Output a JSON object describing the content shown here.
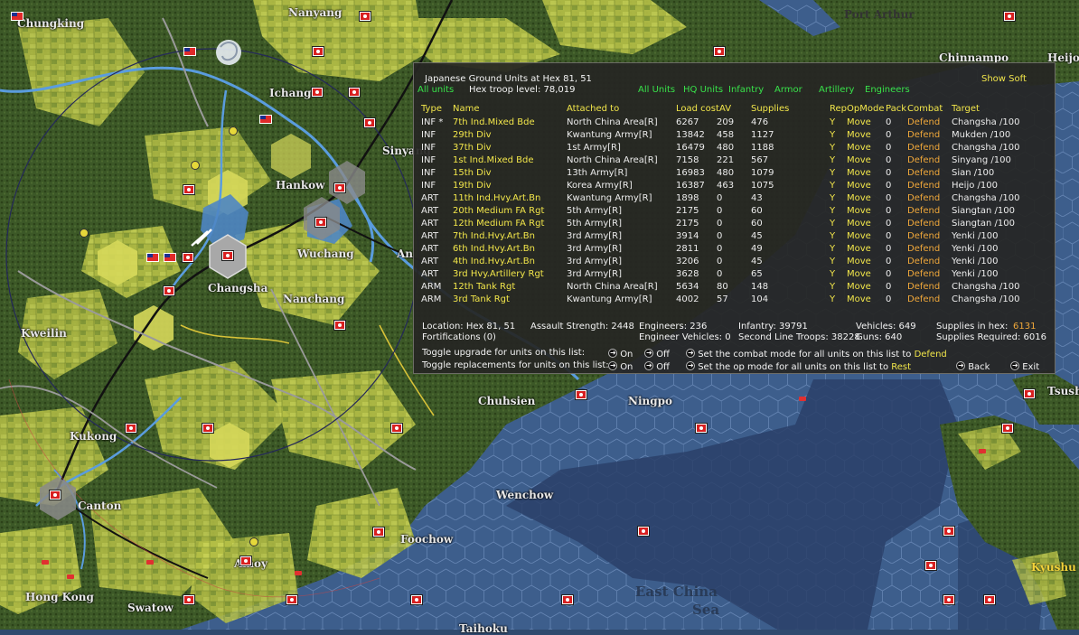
{
  "map": {
    "cities": [
      {
        "name": "Chungking",
        "key": "chungking"
      },
      {
        "name": "Nanyang",
        "key": "nanyang"
      },
      {
        "name": "Port Arthur",
        "key": "port-arthur"
      },
      {
        "name": "Chinnampo",
        "key": "chinnampo"
      },
      {
        "name": "Heijo",
        "key": "heijo"
      },
      {
        "name": "Ichang",
        "key": "ichang"
      },
      {
        "name": "Sinyang",
        "key": "sinyang"
      },
      {
        "name": "Hankow",
        "key": "hankow"
      },
      {
        "name": "Wuchang",
        "key": "wuchang"
      },
      {
        "name": "Anking",
        "key": "anking"
      },
      {
        "name": "Changsha",
        "key": "changsha"
      },
      {
        "name": "Nanchang",
        "key": "nanchang"
      },
      {
        "name": "Kweilin",
        "key": "kweilin"
      },
      {
        "name": "Chuhsien",
        "key": "chuhsien"
      },
      {
        "name": "Ningpo",
        "key": "ningpo"
      },
      {
        "name": "Tsushima",
        "key": "tsushima"
      },
      {
        "name": "Kukong",
        "key": "kukong"
      },
      {
        "name": "Wenchow",
        "key": "wenchow"
      },
      {
        "name": "Canton",
        "key": "canton"
      },
      {
        "name": "Foochow",
        "key": "foochow"
      },
      {
        "name": "Amoy",
        "key": "amoy"
      },
      {
        "name": "Kyushu",
        "key": "kyushu"
      },
      {
        "name": "Hong Kong",
        "key": "hong-kong"
      },
      {
        "name": "Swatow",
        "key": "swatow"
      },
      {
        "name": "Taihoku",
        "key": "taihoku"
      }
    ],
    "sea_label_1": "East China",
    "sea_label_2": "Sea",
    "colors": {
      "ocean": "#3a5a86",
      "deep_ocean": "#2a3f63",
      "forest": "#3e5a2a",
      "plain": "#b8c24a",
      "jungle": "#2f4a22",
      "river": "#5fa0e0",
      "hexline": "#5a7aa8",
      "japan_flag": "#d82020"
    }
  },
  "panel": {
    "title": "Japanese Ground Units at Hex 81, 51",
    "show_soft": "Show Soft",
    "all_units_left": "All units",
    "troop_level": "Hex troop level: 78,019",
    "filters": [
      "All Units",
      "HQ Units",
      "Infantry",
      "Armor",
      "Artillery",
      "Engineers"
    ],
    "headers": {
      "type": "Type",
      "name": "Name",
      "attached": "Attached to",
      "loadcost": "Load cost",
      "av": "AV",
      "supplies": "Supplies",
      "rep": "Rep",
      "opmode": "OpMode",
      "pack": "Pack",
      "combat": "Combat",
      "target": "Target"
    },
    "units": [
      {
        "type": "INF *",
        "name": "7th Ind.Mixed Bde",
        "attached": "North China Area[R]",
        "load": "6267",
        "av": "209",
        "sup": "476",
        "rep": "Y",
        "op": "Move",
        "pack": "0",
        "combat": "Defend",
        "target": "Changsha /100"
      },
      {
        "type": "INF",
        "name": "29th Div",
        "attached": "Kwantung Army[R]",
        "load": "13842",
        "av": "458",
        "sup": "1127",
        "rep": "Y",
        "op": "Move",
        "pack": "0",
        "combat": "Defend",
        "target": "Mukden /100"
      },
      {
        "type": "INF",
        "name": "37th Div",
        "attached": "1st Army[R]",
        "load": "16479",
        "av": "480",
        "sup": "1188",
        "rep": "Y",
        "op": "Move",
        "pack": "0",
        "combat": "Defend",
        "target": "Changsha /100"
      },
      {
        "type": "INF",
        "name": "1st Ind.Mixed Bde",
        "attached": "North China Area[R]",
        "load": "7158",
        "av": "221",
        "sup": "567",
        "rep": "Y",
        "op": "Move",
        "pack": "0",
        "combat": "Defend",
        "target": "Sinyang /100"
      },
      {
        "type": "INF",
        "name": "15th Div",
        "attached": "13th Army[R]",
        "load": "16983",
        "av": "480",
        "sup": "1079",
        "rep": "Y",
        "op": "Move",
        "pack": "0",
        "combat": "Defend",
        "target": "Sian /100"
      },
      {
        "type": "INF",
        "name": "19th Div",
        "attached": "Korea Army[R]",
        "load": "16387",
        "av": "463",
        "sup": "1075",
        "rep": "Y",
        "op": "Move",
        "pack": "0",
        "combat": "Defend",
        "target": "Heijo /100"
      },
      {
        "type": "ART",
        "name": "11th Ind.Hvy.Art.Bn",
        "attached": "Kwantung Army[R]",
        "load": "1898",
        "av": "0",
        "sup": "43",
        "rep": "Y",
        "op": "Move",
        "pack": "0",
        "combat": "Defend",
        "target": "Changsha /100"
      },
      {
        "type": "ART",
        "name": "20th Medium FA Rgt",
        "attached": "5th Army[R]",
        "load": "2175",
        "av": "0",
        "sup": "60",
        "rep": "Y",
        "op": "Move",
        "pack": "0",
        "combat": "Defend",
        "target": "Siangtan /100"
      },
      {
        "type": "ART",
        "name": "12th Medium FA Rgt",
        "attached": "5th Army[R]",
        "load": "2175",
        "av": "0",
        "sup": "60",
        "rep": "Y",
        "op": "Move",
        "pack": "0",
        "combat": "Defend",
        "target": "Siangtan /100"
      },
      {
        "type": "ART",
        "name": "7th Ind.Hvy.Art.Bn",
        "attached": "3rd Army[R]",
        "load": "3914",
        "av": "0",
        "sup": "45",
        "rep": "Y",
        "op": "Move",
        "pack": "0",
        "combat": "Defend",
        "target": "Yenki /100"
      },
      {
        "type": "ART",
        "name": "6th Ind.Hvy.Art.Bn",
        "attached": "3rd Army[R]",
        "load": "2811",
        "av": "0",
        "sup": "49",
        "rep": "Y",
        "op": "Move",
        "pack": "0",
        "combat": "Defend",
        "target": "Yenki /100"
      },
      {
        "type": "ART",
        "name": "4th Ind.Hvy.Art.Bn",
        "attached": "3rd Army[R]",
        "load": "3206",
        "av": "0",
        "sup": "45",
        "rep": "Y",
        "op": "Move",
        "pack": "0",
        "combat": "Defend",
        "target": "Yenki /100"
      },
      {
        "type": "ART",
        "name": "3rd Hvy.Artillery Rgt",
        "attached": "3rd Army[R]",
        "load": "3628",
        "av": "0",
        "sup": "65",
        "rep": "Y",
        "op": "Move",
        "pack": "0",
        "combat": "Defend",
        "target": "Yenki /100"
      },
      {
        "type": "ARM",
        "name": "12th Tank Rgt",
        "attached": "North China Area[R]",
        "load": "5634",
        "av": "80",
        "sup": "148",
        "rep": "Y",
        "op": "Move",
        "pack": "0",
        "combat": "Defend",
        "target": "Changsha /100"
      },
      {
        "type": "ARM",
        "name": "3rd Tank Rgt",
        "attached": "Kwantung Army[R]",
        "load": "4002",
        "av": "57",
        "sup": "104",
        "rep": "Y",
        "op": "Move",
        "pack": "0",
        "combat": "Defend",
        "target": "Changsha /100"
      }
    ],
    "footer": {
      "location": "Location: Hex 81, 51",
      "fortifications": "Fortifications (0)",
      "assault": "Assault Strength: 2448",
      "engineers": "Engineers: 236",
      "eng_vehicles": "Engineer Vehicles: 0",
      "infantry": "Infantry: 39791",
      "second_line": "Second Line Troops: 38228",
      "vehicles": "Vehicles: 649",
      "guns": "Guns: 640",
      "supplies_in_hex_label": "Supplies in hex:",
      "supplies_in_hex_value": "6131",
      "supplies_required": "Supplies Required: 6016",
      "toggle_upgrade": "Toggle upgrade for units on this list:",
      "toggle_replacements": "Toggle replacements for units on this list:",
      "on": "On",
      "off": "Off",
      "set_combat": "Set the combat mode for all units on this list to",
      "combat_value": "Defend",
      "set_op": "Set the op mode for all units on this list to",
      "op_value": "Rest",
      "back": "Back",
      "exit": "Exit"
    }
  }
}
